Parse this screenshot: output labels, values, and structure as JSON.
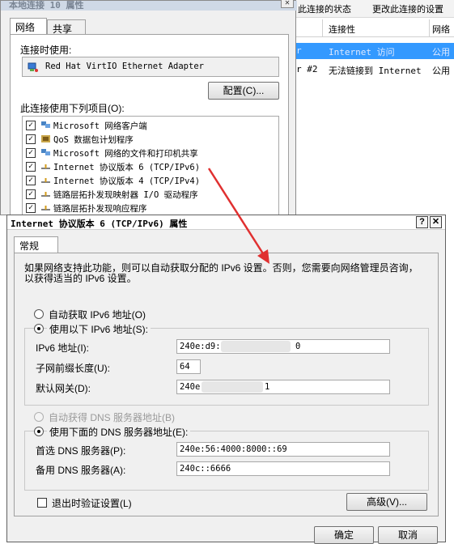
{
  "background_window": {
    "toolbar": {
      "connection_status": "此连接的状态",
      "change_settings": "更改此连接的设置"
    },
    "columns": [
      "连接性",
      "网络"
    ],
    "rows": [
      {
        "left": "r",
        "connectivity": "Internet 访问",
        "network": "公用"
      },
      {
        "left": "r #2",
        "connectivity": "无法链接到 Internet",
        "network": "公用"
      }
    ]
  },
  "adapter_dialog": {
    "title": "本地连接 10 属性",
    "close_icon": "close-icon",
    "tabs": [
      "网络",
      "共享"
    ],
    "connect_using_label": "连接时使用:",
    "adapter_name": "Red Hat VirtIO Ethernet Adapter",
    "configure_button": "配置(C)...",
    "items_label": "此连接使用下列项目(O):",
    "items": [
      {
        "label": "Microsoft 网络客户端",
        "checked": true,
        "icon": "network-client-icon"
      },
      {
        "label": "QoS 数据包计划程序",
        "checked": true,
        "icon": "qos-icon"
      },
      {
        "label": "Microsoft 网络的文件和打印机共享",
        "checked": true,
        "icon": "file-printer-sharing-icon"
      },
      {
        "label": "Internet 协议版本 6 (TCP/IPv6)",
        "checked": true,
        "icon": "protocol-icon"
      },
      {
        "label": "Internet 协议版本 4 (TCP/IPv4)",
        "checked": true,
        "icon": "protocol-icon"
      },
      {
        "label": "链路层拓扑发现映射器 I/O 驱动程序",
        "checked": true,
        "icon": "protocol-icon"
      },
      {
        "label": "链路层拓扑发现响应程序",
        "checked": true,
        "icon": "protocol-icon"
      }
    ]
  },
  "ipv6_dialog": {
    "title": "Internet 协议版本 6 (TCP/IPv6) 属性",
    "help_button": "?",
    "close_button": "✕",
    "tab": "常规",
    "description": "如果网络支持此功能，则可以自动获取分配的 IPv6 设置。否则，您需要向网络管理员咨询，以获得适当的 IPv6 设置。",
    "auto_ip_label": "自动获取 IPv6 地址(O)",
    "manual_ip_label": "使用以下 IPv6 地址(S):",
    "ipv6_address_label": "IPv6 地址(I):",
    "ipv6_address_value_prefix": "240e:d9:",
    "ipv6_address_value_suffix": "0",
    "prefix_length_label": "子网前缀长度(U):",
    "prefix_length_value": "64",
    "gateway_label": "默认网关(D):",
    "gateway_value_prefix": "240e",
    "gateway_value_suffix": "1",
    "auto_dns_label": "自动获得 DNS 服务器地址(B)",
    "manual_dns_label": "使用下面的 DNS 服务器地址(E):",
    "preferred_dns_label": "首选 DNS 服务器(P):",
    "preferred_dns_value": "240e:56:4000:8000::69",
    "alternate_dns_label": "备用 DNS 服务器(A):",
    "alternate_dns_value": "240c::6666",
    "validate_label": "退出时验证设置(L)",
    "advanced_button": "高级(V)...",
    "ok_button": "确定",
    "cancel_button": "取消"
  }
}
